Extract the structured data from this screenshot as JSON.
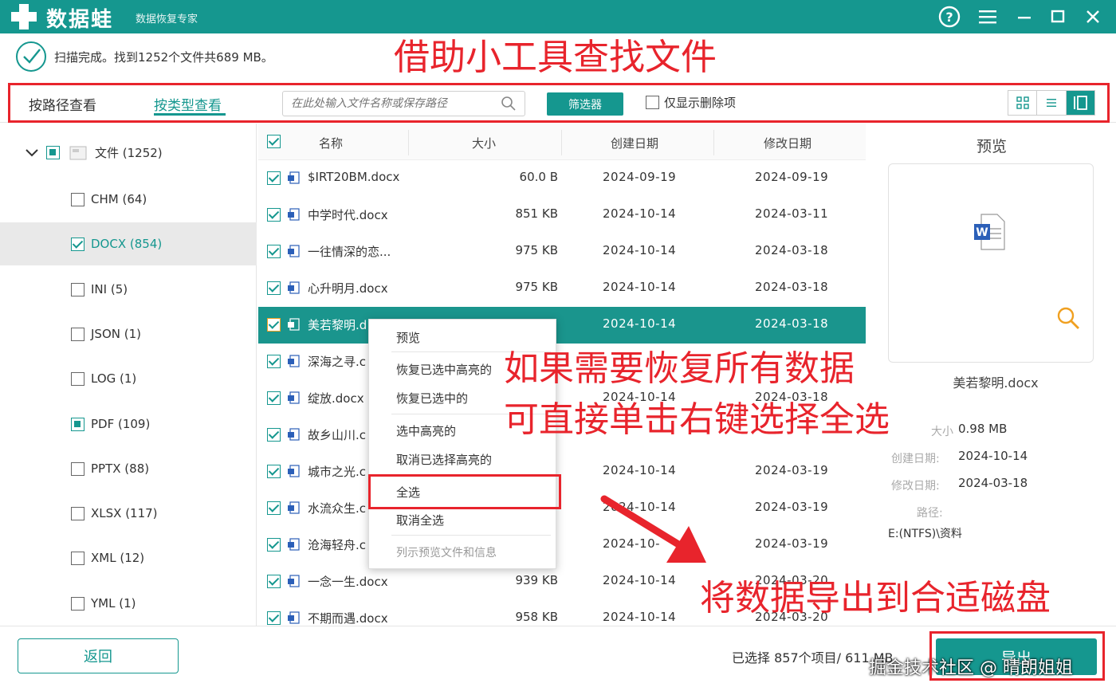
{
  "app": {
    "name": "数据蛙",
    "subtitle": "数据恢复专家"
  },
  "status": {
    "text": "扫描完成。找到1252个文件共689 MB。"
  },
  "annotations": {
    "title": "借助小工具查找文件",
    "mid_line1": "如果需要恢复所有数据",
    "mid_line2": "可直接单击右键选择全选",
    "bottom": "将数据导出到合适磁盘"
  },
  "toolbar": {
    "tab_path": "按路径查看",
    "tab_type": "按类型查看",
    "search_placeholder": "在此处输入文件名称或保存路径",
    "filter_label": "筛选器",
    "deleted_only_label": "仅显示删除项"
  },
  "tree": {
    "root_label": "文件 (1252)",
    "items": [
      {
        "label": "CHM (64)",
        "state": "unchecked"
      },
      {
        "label": "DOCX (854)",
        "state": "checked"
      },
      {
        "label": "INI (5)",
        "state": "unchecked"
      },
      {
        "label": "JSON (1)",
        "state": "unchecked"
      },
      {
        "label": "LOG (1)",
        "state": "unchecked"
      },
      {
        "label": "PDF (109)",
        "state": "partial"
      },
      {
        "label": "PPTX (88)",
        "state": "unchecked"
      },
      {
        "label": "XLSX (117)",
        "state": "unchecked"
      },
      {
        "label": "XML (12)",
        "state": "unchecked"
      },
      {
        "label": "YML (1)",
        "state": "unchecked"
      }
    ]
  },
  "table": {
    "headers": {
      "name": "名称",
      "size": "大小",
      "created": "创建日期",
      "modified": "修改日期"
    },
    "rows": [
      {
        "name": "$IRT20BM.docx",
        "size": "60.0  B",
        "created": "2024-09-19",
        "modified": "2024-09-19"
      },
      {
        "name": "中学时代.docx",
        "size": "851 KB",
        "created": "2024-10-14",
        "modified": "2024-03-11"
      },
      {
        "name": "一往情深的恋...",
        "size": "975 KB",
        "created": "2024-10-14",
        "modified": "2024-03-18"
      },
      {
        "name": "心升明月.docx",
        "size": "975 KB",
        "created": "2024-10-14",
        "modified": "2024-03-18"
      },
      {
        "name": "美若黎明.d",
        "size": "",
        "created": "2024-10-14",
        "modified": "2024-03-18"
      },
      {
        "name": "深海之寻.c",
        "size": "",
        "created": "",
        "modified": ""
      },
      {
        "name": "绽放.docx",
        "size": "",
        "created": "2024-10-14",
        "modified": "2024-03-18"
      },
      {
        "name": "故乡山川.c",
        "size": "",
        "created": "",
        "modified": ""
      },
      {
        "name": "城市之光.c",
        "size": "",
        "created": "2024-10-14",
        "modified": "2024-03-19"
      },
      {
        "name": "水流众生.c",
        "size": "",
        "created": "2024-10-14",
        "modified": "2024-03-19"
      },
      {
        "name": "沧海轻舟.c",
        "size": "",
        "created": "2024-10-",
        "modified": "2024-03-19"
      },
      {
        "name": "一念一生.docx",
        "size": "939 KB",
        "created": "2024-10-14",
        "modified": "2024-03-20"
      },
      {
        "name": "不期而遇.docx",
        "size": "958 KB",
        "created": "2024-10-14",
        "modified": "2024-03-20"
      }
    ]
  },
  "context_menu": {
    "items": [
      "预览",
      "恢复已选中高亮的",
      "恢复已选中的",
      "选中高亮的",
      "取消已选择高亮的",
      "全选",
      "取消全选",
      "列示预览文件和信息"
    ]
  },
  "preview": {
    "title": "预览",
    "file_name": "美若黎明.docx",
    "size_label": "大小",
    "size": "0.98 MB",
    "created_label": "创建日期:",
    "created": "2024-10-14",
    "modified_label": "修改日期:",
    "modified": "2024-03-18",
    "path_label": "路径:",
    "path": "E:(NTFS)\\资料"
  },
  "footer": {
    "back_label": "返回",
    "selection_info": "已选择 857个项目/ 611 MB",
    "export_label": "导出",
    "watermark": "掘金技术社区 @ 晴朗姐姐"
  },
  "colors": {
    "brand": "#15978f",
    "annotation": "#e8242c"
  }
}
